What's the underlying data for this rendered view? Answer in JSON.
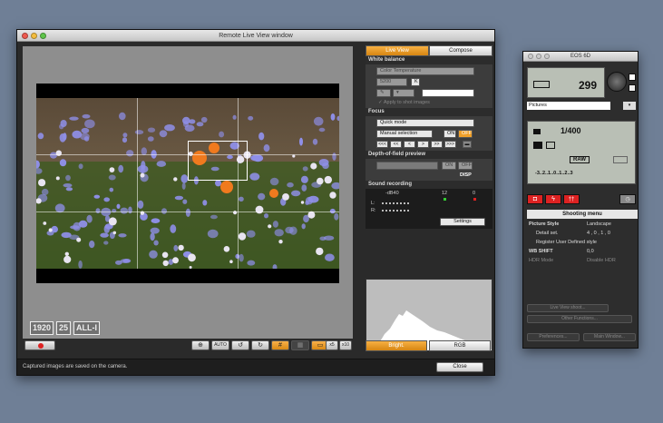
{
  "main_window": {
    "title": "Remote Live View window",
    "format_badges": [
      "1920",
      "25",
      "ALL-I"
    ],
    "status_text": "Captured images are saved on the camera.",
    "close_label": "Close",
    "tools": {
      "auto_label": "AUTO",
      "zoom_5x": "x5",
      "zoom_10x": "x10"
    }
  },
  "panel": {
    "tabs": [
      "Live View",
      "Compose"
    ],
    "white_balance": {
      "title": "White balance",
      "mode": "Color Temperature",
      "kelvin": "5200",
      "k_label": "K",
      "apply_label": "Apply to shot images"
    },
    "focus": {
      "title": "Focus",
      "mode": "Quick mode",
      "selection": "Manual selection",
      "on_label": "ON",
      "off_label": "OFF",
      "nav": [
        "<<<",
        "<<",
        "<",
        ">",
        ">>",
        ">>>"
      ]
    },
    "dof": {
      "title": "Depth-of-field preview",
      "on_label": "ON",
      "off_label": "OFF",
      "disp_label": "DISP"
    },
    "sound": {
      "title": "Sound recording",
      "db_label": "-dB40",
      "mark_12": "12",
      "mark_0": "0",
      "left_label": "L:",
      "right_label": "R:",
      "settings_label": "Settings"
    },
    "histogram": {
      "bright_label": "Bright.",
      "rgb_label": "RGB"
    }
  },
  "camera_window": {
    "title": "EOS 6D",
    "shots_remaining": "299",
    "folder": "Pictures",
    "shutter": "1/400",
    "quality": "RAW",
    "exposure_scale": "-3..2..1..0..1..2..3",
    "menu_title": "Shooting menu",
    "rows": [
      {
        "key": "Picture Style",
        "value": "Landscape"
      },
      {
        "key": "Detail set.",
        "value": "4 , 0 , 1 , 0"
      },
      {
        "key": "Register User Defined style",
        "value": ""
      },
      {
        "key": "WB SHIFT",
        "value": "0,0"
      },
      {
        "key": "HDR Mode",
        "value": "Disable HDR"
      }
    ],
    "live_view_shoot_label": "Live View shoot...",
    "other_functions_label": "Other Functions...",
    "preferences_label": "Preferences...",
    "main_window_label": "Main Window..."
  }
}
